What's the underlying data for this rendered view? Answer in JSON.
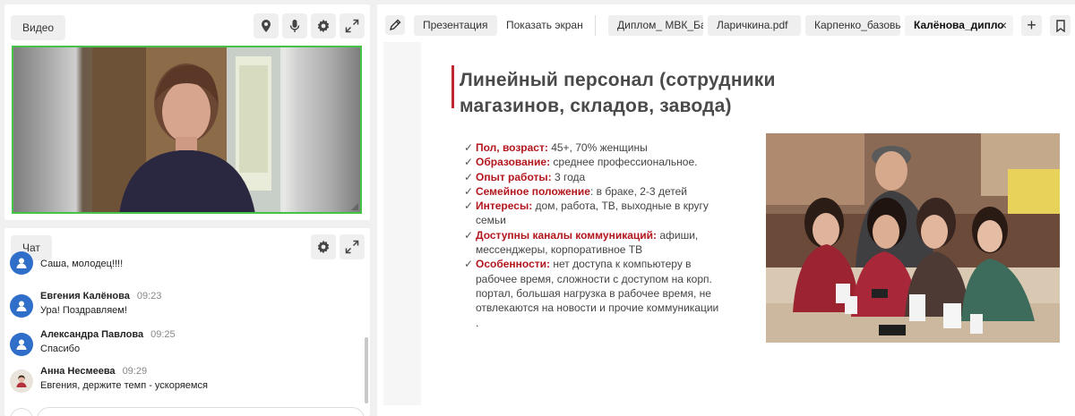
{
  "video": {
    "title": "Видео"
  },
  "chat": {
    "title": "Чат",
    "messages": [
      {
        "name": "",
        "time": "",
        "text": "Саша, молодец!!!!"
      },
      {
        "name": "Евгения Калёнова",
        "time": "09:23",
        "text": "Ура! Поздравляем!"
      },
      {
        "name": "Александра Павлова",
        "time": "09:25",
        "text": "Спасибо"
      },
      {
        "name": "Анна Несмеева",
        "time": "09:29",
        "text": "Евгения, держите темп - ускоряемся"
      }
    ]
  },
  "tabs": {
    "presentation": "Презентация",
    "show_screen": "Показать экран",
    "files": [
      "Диплом_ МВК_Ба",
      "Ларичкина.pdf",
      "Карпенко_базовы",
      "Калёнова_дипло"
    ],
    "plus": "+",
    "close": "×"
  },
  "slide": {
    "title_line1": "Линейный персонал (сотрудники",
    "title_line2": "магазинов, складов, завода)",
    "bullets": [
      {
        "label": "Пол, возраст:",
        "text": " 45+, 70% женщины"
      },
      {
        "label": "Образование:",
        "text": " среднее  профессиональное."
      },
      {
        "label": "Опыт работы:",
        "text": "  3 года"
      },
      {
        "label": "Семейное положение",
        "text": ": в браке, 2-3 детей"
      },
      {
        "label": "Интересы:",
        "text": " дом, работа, ТВ, выходные в кругу семьи"
      },
      {
        "label": "Доступны каналы коммуникаций:",
        "text": " афиши, мессенджеры, корпоративное ТВ"
      },
      {
        "label": "Особенности:",
        "text": " нет доступа к компьютеру в рабочее время, сложности с доступом на корп. портал, большая нагрузка в рабочее время, не отвлекаются на новости и прочие коммуникации"
      }
    ],
    "trailing": ".",
    "check": "✓"
  },
  "colors": {
    "accent_red": "#b3171e",
    "video_border": "#46c24a",
    "avatar_blue": "#2f6fc9"
  },
  "icons": [
    "pin-icon",
    "microphone-icon",
    "gear-icon",
    "expand-icon",
    "pen-icon",
    "bookmark-icon",
    "user-icon"
  ]
}
